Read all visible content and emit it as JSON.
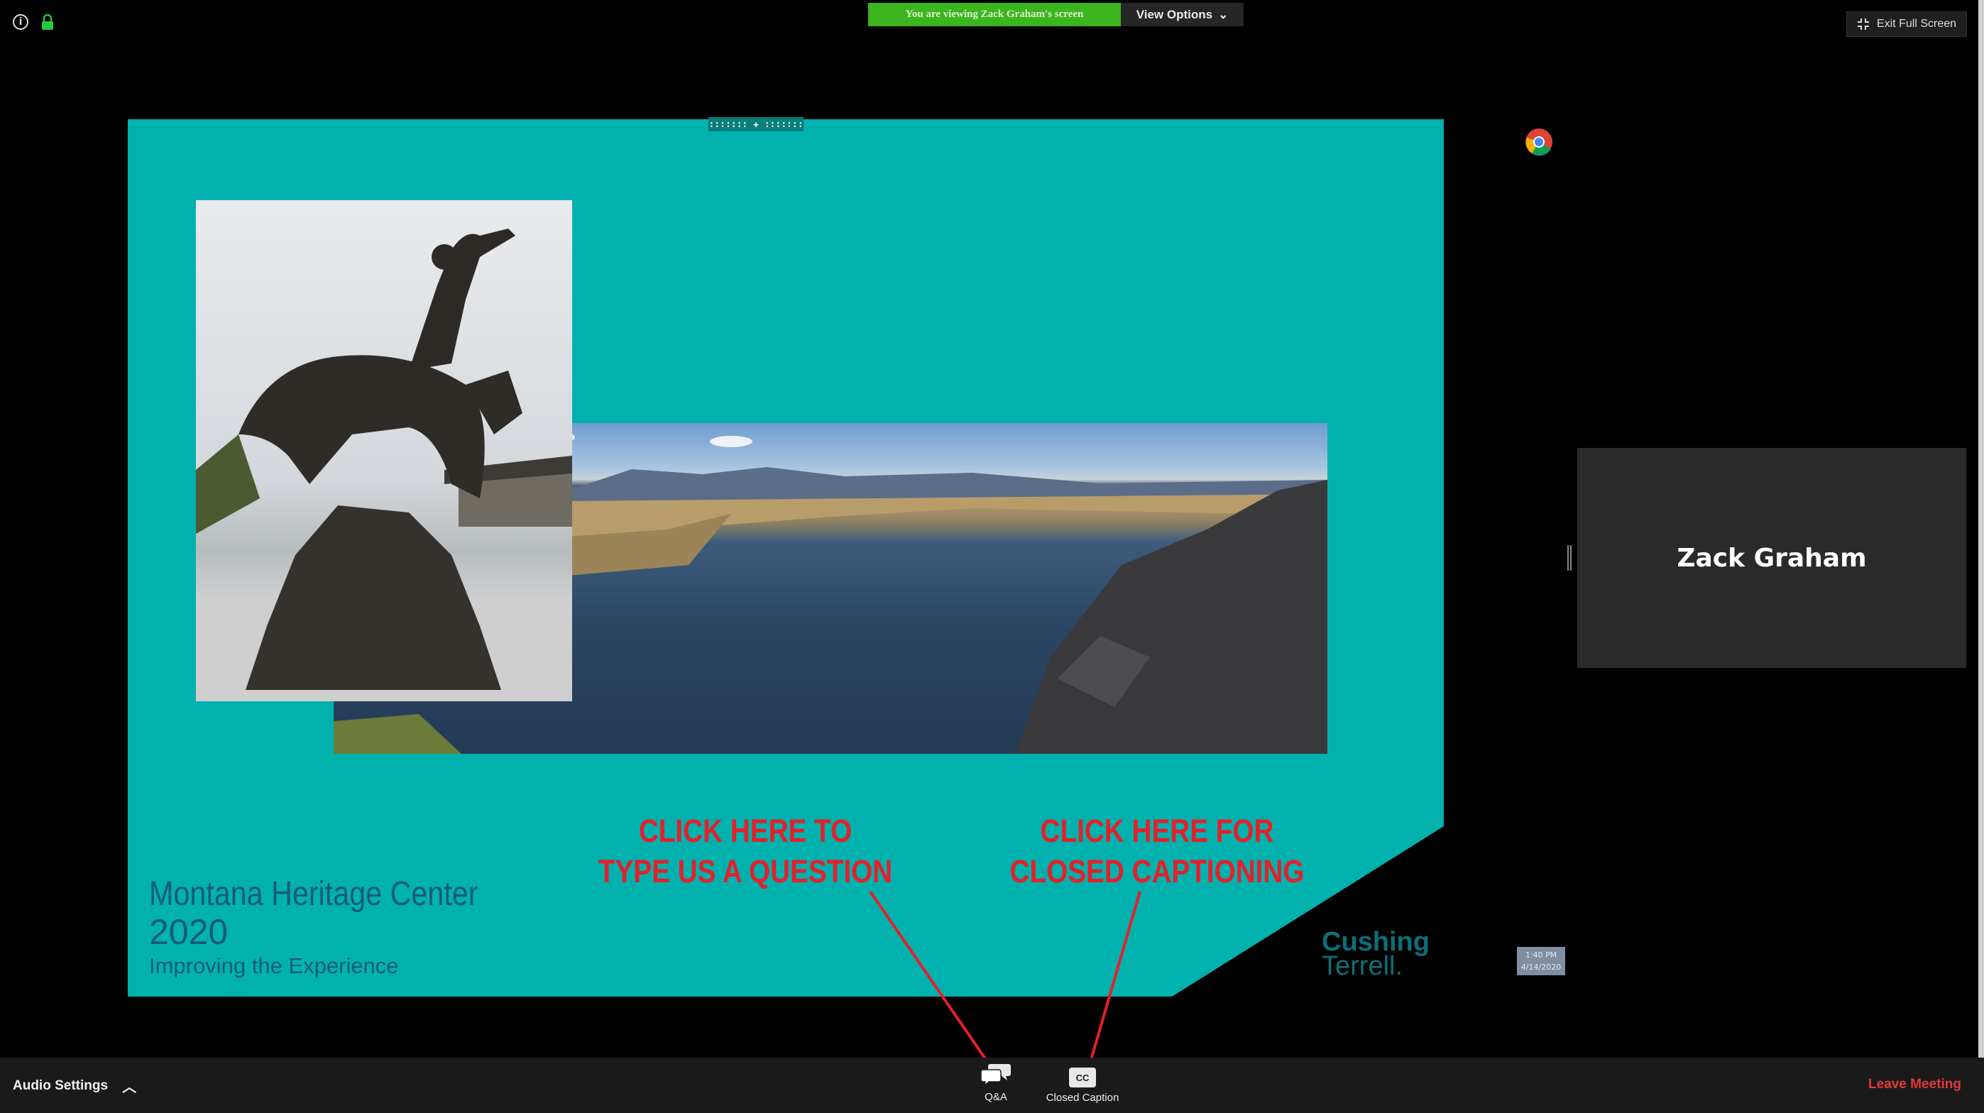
{
  "top_bar": {
    "viewing_banner": "You are viewing Zack Graham's screen",
    "view_options": "View Options",
    "exit_full_screen": "Exit Full Screen"
  },
  "slide": {
    "handle": "::::::: ✚ :::::::",
    "title_line1": "Montana Heritage Center",
    "title_line2": "2020",
    "subtitle": "Improving the Experience",
    "logo_line1": "Cushing",
    "logo_line2": "Terrell."
  },
  "participant": {
    "name": "Zack Graham"
  },
  "clock": {
    "time": "1:40 PM",
    "date": "4/14/2020"
  },
  "annotations": {
    "question_line1": "CLICK HERE TO",
    "question_line2": "TYPE US A QUESTION",
    "caption_line1": "CLICK HERE FOR",
    "caption_line2": "CLOSED CAPTIONING",
    "color": "#e4202a"
  },
  "toolbar": {
    "audio_settings": "Audio Settings",
    "qa_label": "Q&A",
    "cc_icon_text": "CC",
    "closed_caption_label": "Closed Caption",
    "leave_meeting": "Leave Meeting"
  },
  "colors": {
    "slide_teal": "#01b1ae",
    "banner_green": "#3cb521",
    "leave_red": "#e23a3a"
  }
}
